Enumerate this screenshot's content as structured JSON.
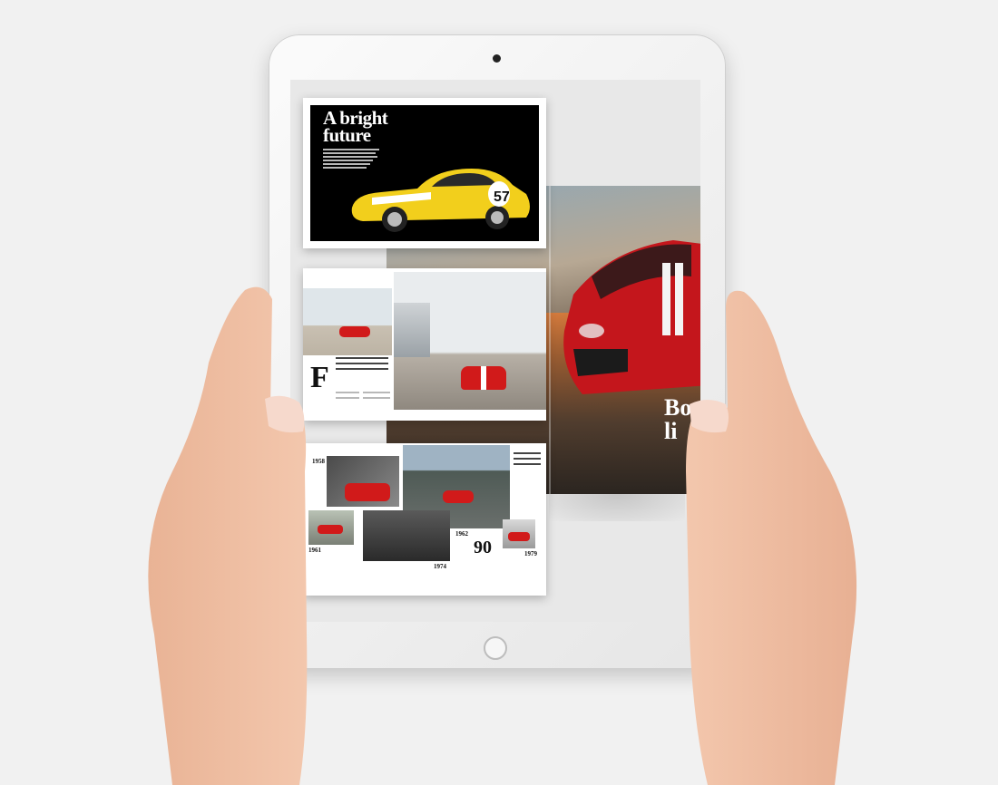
{
  "magazine": {
    "feature_title": "A bright\nfuture",
    "hero_text_partial": "Bo\nli",
    "car_number": "57",
    "page2_dropcap": "F",
    "page3_years": [
      "1958",
      "1961",
      "1962",
      "1974",
      "1979"
    ],
    "page3_badge": "90"
  },
  "colors": {
    "background": "#f1f1f1",
    "ipad_body": "#f3f3f3",
    "ferrari_red": "#d11a1a",
    "car_yellow": "#f2cf1c"
  }
}
